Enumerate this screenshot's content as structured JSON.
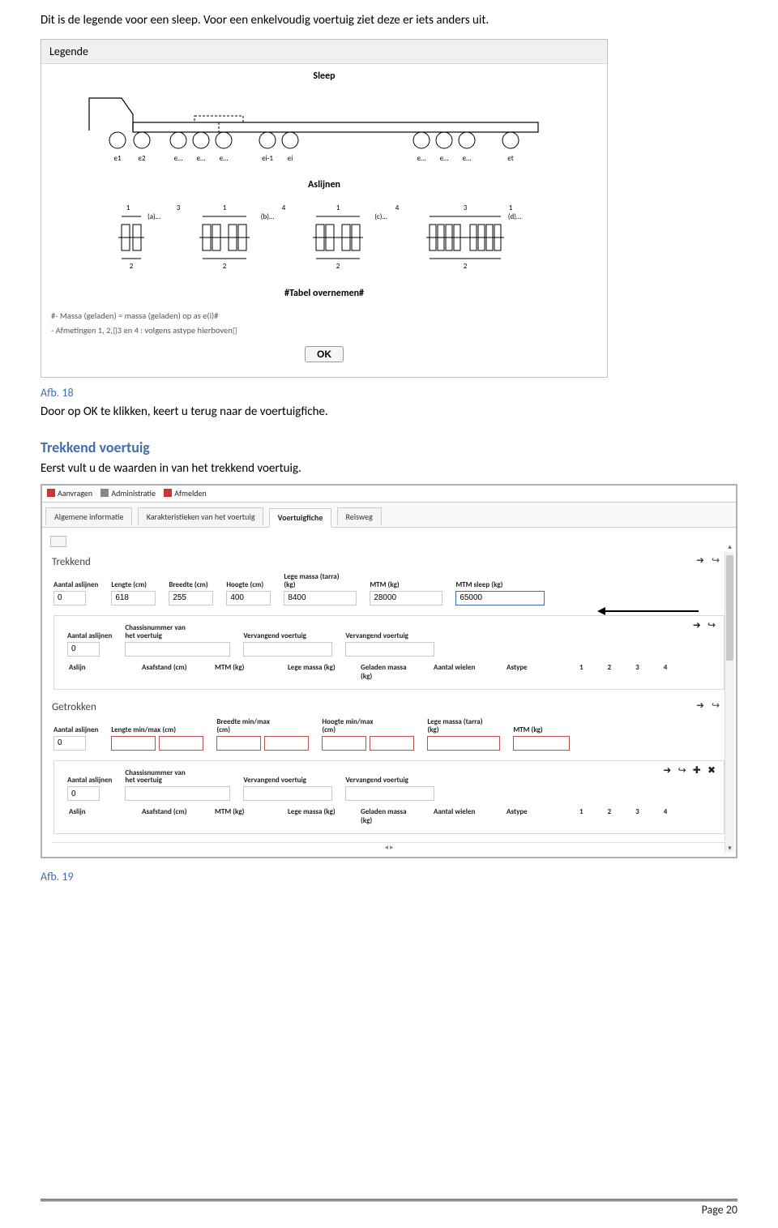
{
  "intro": "Dit is de legende voor een sleep. Voor een enkelvoudig voertuig ziet deze er iets anders uit.",
  "legende": {
    "title": "Legende",
    "sleep_label": "Sleep",
    "axles": [
      "e1",
      "e2",
      "e…",
      "e…",
      "e…",
      "ei-1",
      "ei",
      "e…",
      "e…",
      "e…",
      "et"
    ],
    "aslijnen_label": "Aslijnen",
    "groupLabels": [
      "(a)…",
      "(b)…",
      "(c)…",
      "(d)…"
    ],
    "topNums": [
      "1",
      "3",
      "1",
      "4",
      "1",
      "4",
      "3",
      "1"
    ],
    "botNums": [
      "2",
      "2",
      "2",
      "2"
    ],
    "tabel_label": "#Tabel overnemen#",
    "note1": "#- Massa (geladen) = massa (geladen) op as e(i)#",
    "note2": "- Afmetingen 1, 2,▯3 en 4 : volgens astype hierboven▯",
    "ok": "OK"
  },
  "afb18": "Afb. 18",
  "para_ok": "Door op OK te klikken, keert u terug naar de voertuigfiche.",
  "h2": "Trekkend voertuig",
  "para_tr": "Eerst vult u de waarden in van het trekkend voertuig.",
  "app": {
    "menu": {
      "aanvragen": "Aanvragen",
      "administratie": "Administratie",
      "afmelden": "Afmelden"
    },
    "tabs": {
      "alg": "Algemene informatie",
      "kar": "Karakteristieken van het voertuig",
      "fiche": "Voertuigfiche",
      "reis": "Reisweg"
    },
    "trekkend": {
      "title": "Trekkend",
      "labels": {
        "aantal_as": "Aantal aslijnen",
        "lengte": "Lengte (cm)",
        "breedte": "Breedte (cm)",
        "hoogte": "Hoogte (cm)",
        "lege": "Lege massa (tarra) (kg)",
        "mtm": "MTM (kg)",
        "mtm_sleep": "MTM sleep (kg)",
        "chassis": "Chassisnummer van het voertuig",
        "verv1": "Vervangend voertuig",
        "verv2": "Vervangend voertuig",
        "aslijn": "Aslijn",
        "asafstand": "Asafstand (cm)",
        "mtm2": "MTM (kg)",
        "legem": "Lege massa (kg)",
        "geladen": "Geladen massa (kg)",
        "wielen": "Aantal wielen",
        "astype": "Astype"
      },
      "values": {
        "aantal_as": "0",
        "lengte": "618",
        "breedte": "255",
        "hoogte": "400",
        "lege": "8400",
        "mtm": "28000",
        "mtm_sleep": "65000",
        "sub_aantal": "0"
      },
      "nums": [
        "1",
        "2",
        "3",
        "4"
      ]
    },
    "getrokken": {
      "title": "Getrokken",
      "labels": {
        "aantal_as": "Aantal aslijnen",
        "lengte_mm": "Lengte min/max (cm)",
        "breedte_mm": "Breedte min/max (cm)",
        "hoogte_mm": "Hoogte min/max (cm)",
        "lege": "Lege massa (tarra) (kg)",
        "mtm": "MTM (kg)",
        "chassis": "Chassisnummer van het voertuig",
        "verv1": "Vervangend voertuig",
        "verv2": "Vervangend voertuig",
        "aslijn": "Aslijn",
        "asafstand": "Asafstand (cm)",
        "mtm2": "MTM (kg)",
        "legem": "Lege massa (kg)",
        "geladen": "Geladen massa (kg)",
        "wielen": "Aantal wielen",
        "astype": "Astype"
      },
      "values": {
        "aantal_as": "0",
        "sub_aantal": "0"
      },
      "nums": [
        "1",
        "2",
        "3",
        "4"
      ]
    }
  },
  "afb19": "Afb. 19",
  "footer": "Page 20"
}
